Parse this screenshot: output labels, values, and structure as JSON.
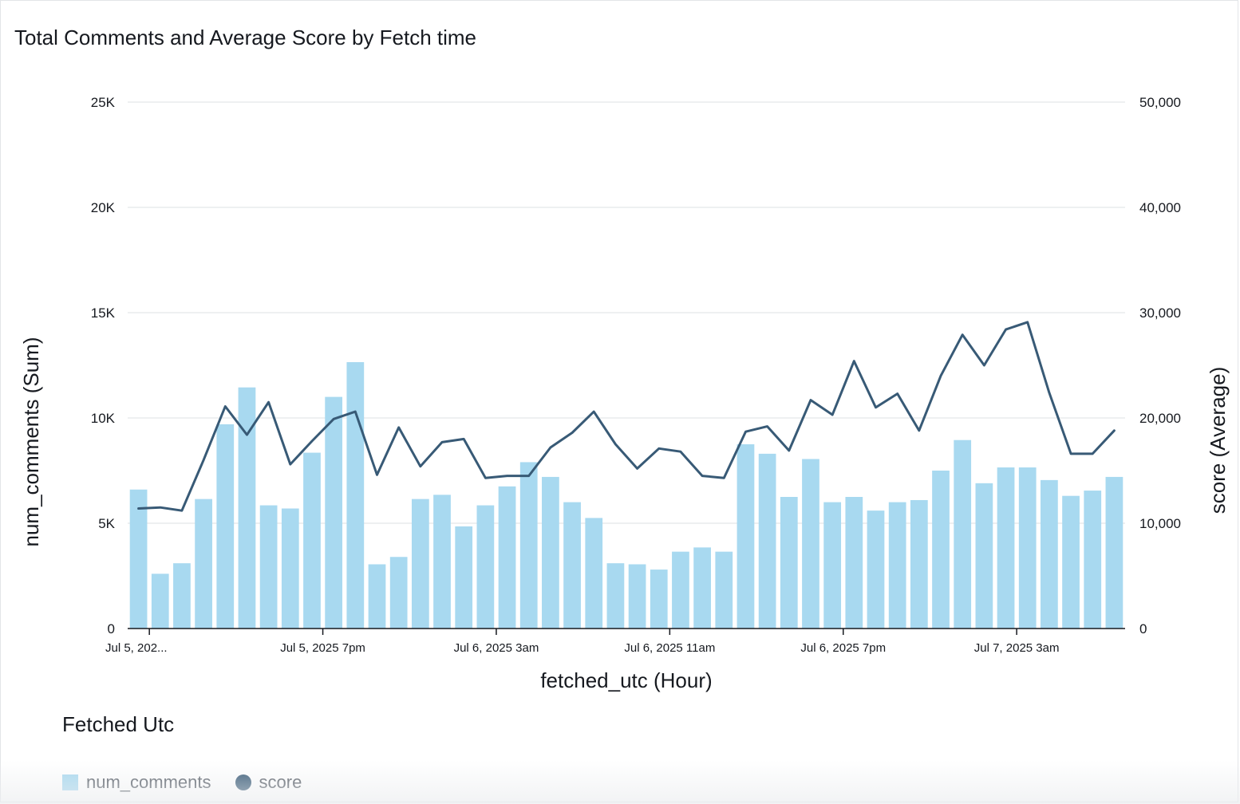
{
  "chart_data": {
    "type": "bar",
    "title": "Total Comments and Average Score by Fetch time",
    "xlabel": "fetched_utc (Hour)",
    "ylabel": "num_comments (Sum)",
    "y2label": "score (Average)",
    "ylim": [
      0,
      25000
    ],
    "y2lim": [
      0,
      50000
    ],
    "y_ticks": [
      "0",
      "5K",
      "10K",
      "15K",
      "20K",
      "25K"
    ],
    "y2_ticks": [
      "0",
      "10,000",
      "20,000",
      "30,000",
      "40,000",
      "50,000"
    ],
    "x_tick_labels": [
      {
        "index": 1,
        "label": "Jul 5, 202..."
      },
      {
        "index": 9,
        "label": "Jul 5, 2025 7pm"
      },
      {
        "index": 17,
        "label": "Jul 6, 2025 3am"
      },
      {
        "index": 25,
        "label": "Jul 6, 2025 11am"
      },
      {
        "index": 33,
        "label": "Jul 6, 2025 7pm"
      },
      {
        "index": 41,
        "label": "Jul 7, 2025 3am"
      }
    ],
    "grid": true,
    "legend_position": "bottom-left",
    "legend_title": "Fetched Utc",
    "series": [
      {
        "name": "num_comments",
        "type": "bar",
        "axis": "left",
        "color": "#a8d9f0",
        "values": [
          6600,
          2600,
          3100,
          6150,
          9700,
          11450,
          5850,
          5700,
          8350,
          11000,
          12650,
          3050,
          3400,
          6150,
          6350,
          4850,
          5850,
          6750,
          7900,
          7200,
          6000,
          5250,
          3100,
          3050,
          2800,
          3650,
          3850,
          3650,
          8750,
          8300,
          6250,
          8050,
          6000,
          6250,
          5600,
          6000,
          6100,
          7500,
          8950,
          6900,
          7650,
          7650,
          7050,
          6300,
          6550,
          7200
        ]
      },
      {
        "name": "score",
        "type": "line",
        "axis": "right",
        "color": "#385a76",
        "values": [
          11400,
          11500,
          11200,
          16000,
          21100,
          18400,
          21500,
          15600,
          17800,
          19900,
          20600,
          14600,
          19100,
          15400,
          17700,
          18000,
          14300,
          14500,
          14500,
          17200,
          18600,
          20600,
          17500,
          15200,
          17100,
          16800,
          14500,
          14300,
          18700,
          19200,
          16900,
          21700,
          20300,
          25400,
          21000,
          22300,
          18800,
          24000,
          27900,
          25000,
          28400,
          29100,
          22400,
          16600,
          16600,
          18800
        ]
      }
    ]
  }
}
